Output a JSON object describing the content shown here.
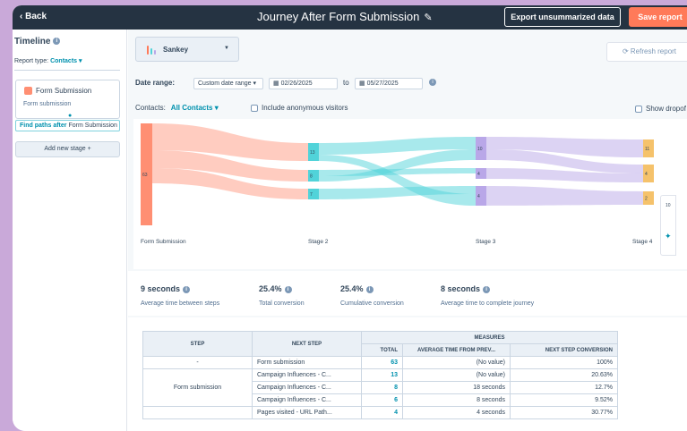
{
  "topbar": {
    "back_label": "Back",
    "title": "Journey After Form Submission",
    "export_label": "Export unsummarized data",
    "save_label": "Save report"
  },
  "sidebar": {
    "title": "Timeline",
    "report_type_label": "Report type:",
    "report_type_value": "Contacts",
    "stage_name": "Form Submission",
    "stage_sub": "Form submission",
    "find_paths_bold": "Find paths after",
    "find_paths_rest": "Form Submission",
    "add_stage_label": "Add new stage"
  },
  "toolbar": {
    "chart_type": "Sankey",
    "refresh_label": "Refresh report",
    "date_range_label": "Date range:",
    "date_range_value": "Custom date range",
    "start_date": "02/26/2025",
    "to_label": "to",
    "end_date": "05/27/2025",
    "contacts_label": "Contacts:",
    "contacts_value": "All Contacts",
    "anonymous_label": "Include anonymous visitors",
    "show_dropoff_label": "Show dropof"
  },
  "chart_data": {
    "type": "sankey",
    "stages": [
      "Form Submission",
      "Stage 2",
      "Stage 3",
      "Stage 4"
    ],
    "nodes": [
      {
        "stage": "Form Submission",
        "value": 63,
        "color": "#ff8f73"
      },
      {
        "stage": "Stage 2",
        "value": 13,
        "color": "#51d3d9"
      },
      {
        "stage": "Stage 2",
        "value": 8,
        "color": "#51d3d9"
      },
      {
        "stage": "Stage 2",
        "value": 7,
        "color": "#51d3d9"
      },
      {
        "stage": "Stage 3",
        "value": 10,
        "color": "#b9a7e8"
      },
      {
        "stage": "Stage 3",
        "value": 4,
        "color": "#b9a7e8"
      },
      {
        "stage": "Stage 3",
        "value": 4,
        "color": "#b9a7e8"
      },
      {
        "stage": "Stage 4",
        "value": 11,
        "color": "#f5c26b"
      },
      {
        "stage": "Stage 4",
        "value": 4,
        "color": "#f5c26b"
      },
      {
        "stage": "Stage 4",
        "value": 2,
        "color": "#f5c26b"
      }
    ]
  },
  "stats": [
    {
      "value": "9 seconds",
      "label": "Average time between steps"
    },
    {
      "value": "25.4%",
      "label": "Total conversion"
    },
    {
      "value": "25.4%",
      "label": "Cumulative conversion"
    },
    {
      "value": "8 seconds",
      "label": "Average time to complete journey"
    }
  ],
  "table": {
    "h_step": "STEP",
    "h_next": "NEXT STEP",
    "h_measures": "MEASURES",
    "h_total": "TOTAL",
    "h_avg": "AVERAGE TIME FROM PREV...",
    "h_conv": "NEXT STEP CONVERSION",
    "rows": [
      {
        "step": "-",
        "next": "Form submission",
        "total": "63",
        "avg": "(No value)",
        "conv": "100%"
      },
      {
        "step": "Form submission",
        "next": "Campaign Influences - C...",
        "total": "13",
        "avg": "(No value)",
        "conv": "20.63%"
      },
      {
        "step": "",
        "next": "Campaign Influences - C...",
        "total": "8",
        "avg": "18 seconds",
        "conv": "12.7%"
      },
      {
        "step": "",
        "next": "Campaign Influences - C...",
        "total": "6",
        "avg": "8 seconds",
        "conv": "9.52%"
      },
      {
        "step": "",
        "next": "Pages visited - URL Path...",
        "total": "4",
        "avg": "4 seconds",
        "conv": "30.77%"
      }
    ]
  },
  "side_widget_text": "10"
}
